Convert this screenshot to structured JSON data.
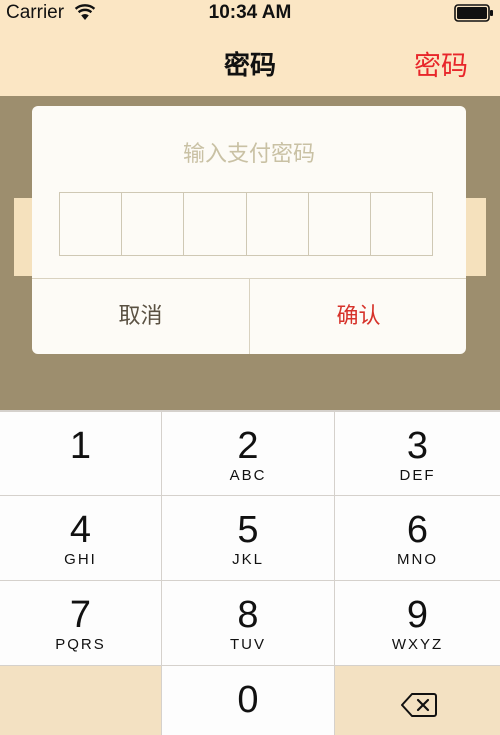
{
  "status_bar": {
    "carrier": "Carrier",
    "time": "10:34 AM",
    "wifi_icon": "wifi-icon",
    "battery_icon": "battery-icon"
  },
  "nav": {
    "title": "密码",
    "right_button": "密码"
  },
  "dialog": {
    "title": "输入支付密码",
    "cells": 6,
    "cancel_label": "取消",
    "confirm_label": "确认"
  },
  "keypad": {
    "keys": [
      {
        "digit": "1",
        "letters": ""
      },
      {
        "digit": "2",
        "letters": "ABC"
      },
      {
        "digit": "3",
        "letters": "DEF"
      },
      {
        "digit": "4",
        "letters": "GHI"
      },
      {
        "digit": "5",
        "letters": "JKL"
      },
      {
        "digit": "6",
        "letters": "MNO"
      },
      {
        "digit": "7",
        "letters": "PQRS"
      },
      {
        "digit": "8",
        "letters": "TUV"
      },
      {
        "digit": "9",
        "letters": "WXYZ"
      },
      {
        "digit": "0",
        "letters": ""
      }
    ],
    "delete_icon": "backspace-icon"
  },
  "colors": {
    "nav_background": "#fbe6c4",
    "accent_red": "#e8262a",
    "overlay": "#9d8e6e"
  }
}
